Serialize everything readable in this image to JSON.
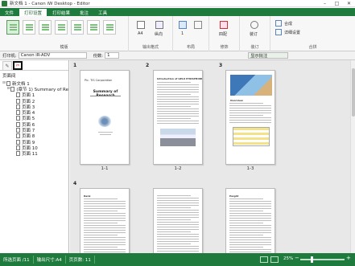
{
  "app": {
    "title": "新文档 1 - Canon iW Desktop - Editor"
  },
  "window_controls": {
    "min": "–",
    "max": "□",
    "close": "✕"
  },
  "tabs": [
    "文件",
    "打印设置",
    "打印结果",
    "批注",
    "工具"
  ],
  "ribbon": {
    "groups": [
      "模版",
      "输出格式",
      "布局",
      "修饰",
      "装订",
      "合拼"
    ],
    "a4_label": "A4",
    "orientation_label": "纵向",
    "pages_label": "1",
    "print_label": "四配",
    "bind_label": "装订",
    "pick_label1": "合成",
    "pick_label2": "详细设置"
  },
  "optbar": {
    "printer_label": "打印机:",
    "printer_value": "Canon iR-ADV",
    "copies_label": "份数:",
    "copies_value": "1",
    "icon_text": "显示批注"
  },
  "sidepanel": {
    "title": "页面间",
    "tree": [
      {
        "level": 0,
        "label": "新文档 1",
        "twist": "−"
      },
      {
        "level": 1,
        "label": "(章节 1) Summary of Re",
        "twist": "−"
      },
      {
        "level": 2,
        "label": "页面 1"
      },
      {
        "level": 2,
        "label": "页面 2"
      },
      {
        "level": 2,
        "label": "页面 3"
      },
      {
        "level": 2,
        "label": "页面 4"
      },
      {
        "level": 2,
        "label": "页面 5"
      },
      {
        "level": 2,
        "label": "页面 6"
      },
      {
        "level": 2,
        "label": "页面 7"
      },
      {
        "level": 2,
        "label": "页面 8"
      },
      {
        "level": 2,
        "label": "页面 9"
      },
      {
        "level": 2,
        "label": "页面 10"
      },
      {
        "level": 2,
        "label": "页面 11"
      }
    ]
  },
  "pages": [
    {
      "num": "1",
      "label": "1-1",
      "title": "Summary of Research",
      "company": "Pic. TIS Corporation"
    },
    {
      "num": "2",
      "label": "1-2",
      "heading": "Introduction of GELX PHOSPHORE"
    },
    {
      "num": "3",
      "label": "1-3",
      "heading": "Overview"
    },
    {
      "num": "4",
      "label": "",
      "heading": "Rank"
    },
    {
      "num": "5",
      "label": "",
      "heading": ""
    },
    {
      "num": "6",
      "label": "",
      "heading": "Height"
    }
  ],
  "status": {
    "pages_total": "所选页面 /11",
    "paper": "输出尺寸:A4",
    "count": "页页数: 11",
    "zoom": "25%"
  },
  "colors": {
    "green": "#1f7a3d"
  }
}
